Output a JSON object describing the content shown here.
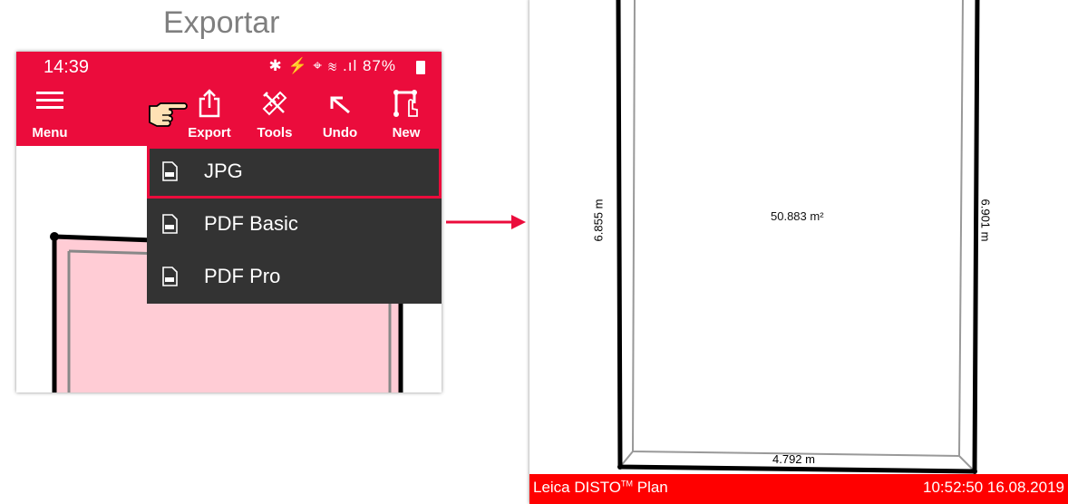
{
  "page_title": "Exportar",
  "phone": {
    "status_bar": {
      "time": "14:39",
      "icons": "✱ ⚡ ⌖ ≋ .ıl",
      "battery": "87%"
    },
    "app_bar": {
      "menu_label": "Menu",
      "export_label": "Export",
      "tools_label": "Tools",
      "undo_label": "Undo",
      "new_label": "New"
    },
    "export_menu": [
      {
        "label": "JPG",
        "icon": "jpg-file-icon",
        "selected": true
      },
      {
        "label": "PDF Basic",
        "icon": "pdf-file-icon",
        "selected": false
      },
      {
        "label": "PDF Pro",
        "icon": "pdf-file-icon",
        "selected": false
      }
    ]
  },
  "exported_plan": {
    "area": "50.883 m²",
    "left_dimension": "6.855 m",
    "right_dimension": "6.901 m",
    "bottom_dimension": "4.792 m",
    "footer_brand": "Leica DISTO",
    "footer_brand_tm": "TM",
    "footer_brand_suffix": " Plan",
    "footer_timestamp": "10:52:50 16.08.2019"
  },
  "colors": {
    "accent": "#eb0c3c",
    "menu_background": "#333333",
    "footer": "#ff0000",
    "room_fill": "#ffccd5"
  }
}
